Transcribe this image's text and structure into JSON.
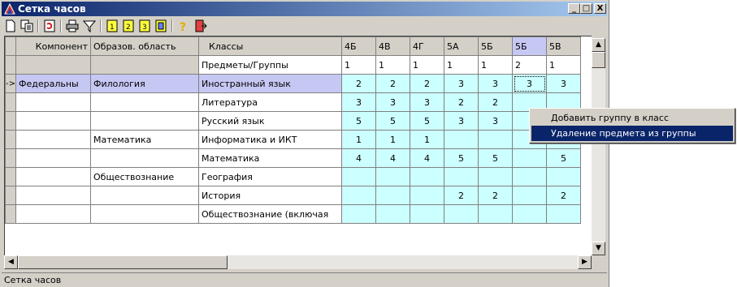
{
  "window": {
    "title": "Сетка часов"
  },
  "titlebar_buttons": {
    "minimize": "_",
    "maximize": "□",
    "close": "X"
  },
  "toolbar": {
    "items": [
      "new-icon",
      "copy-icon",
      "refresh-icon",
      "print-icon",
      "filter-icon",
      "doc1-icon",
      "doc2-icon",
      "doc3-icon",
      "report-icon",
      "help-icon",
      "exit-icon"
    ]
  },
  "grid": {
    "columns": [
      "Компонент",
      "Образов. область",
      "Классы",
      "4Б",
      "4В",
      "4Г",
      "5А",
      "5Б",
      "5Б",
      "5В"
    ],
    "subheader": {
      "label": "Предметы/Группы",
      "values": [
        "1",
        "1",
        "1",
        "1",
        "1",
        "2",
        "1"
      ]
    },
    "rows": [
      {
        "indicator": "->",
        "component": "Федеральны",
        "area": "Филология",
        "subject": "Иностранный язык",
        "values": [
          "2",
          "2",
          "2",
          "3",
          "3",
          "3",
          "3"
        ]
      },
      {
        "indicator": "",
        "component": "",
        "area": "",
        "subject": "Литература",
        "values": [
          "3",
          "3",
          "3",
          "2",
          "2",
          "",
          ""
        ]
      },
      {
        "indicator": "",
        "component": "",
        "area": "",
        "subject": "Русский язык",
        "values": [
          "5",
          "5",
          "5",
          "3",
          "3",
          "",
          ""
        ]
      },
      {
        "indicator": "",
        "component": "",
        "area": "Математика",
        "subject": "Информатика и ИКТ",
        "values": [
          "1",
          "1",
          "1",
          "",
          "",
          "",
          ""
        ]
      },
      {
        "indicator": "",
        "component": "",
        "area": "",
        "subject": "Математика",
        "values": [
          "4",
          "4",
          "4",
          "5",
          "5",
          "",
          "5"
        ]
      },
      {
        "indicator": "",
        "component": "",
        "area": "Обществознание",
        "subject": "География",
        "values": [
          "",
          "",
          "",
          "",
          "",
          "",
          ""
        ]
      },
      {
        "indicator": "",
        "component": "",
        "area": "",
        "subject": "История",
        "values": [
          "",
          "",
          "",
          "2",
          "2",
          "",
          "2"
        ]
      },
      {
        "indicator": "",
        "component": "",
        "area": "",
        "subject": "Обществознание (включая",
        "values": [
          "",
          "",
          "",
          "",
          "",
          "",
          ""
        ]
      }
    ]
  },
  "context_menu": {
    "items": [
      "Добавить группу в класс",
      "Удаление предмета из группы"
    ]
  },
  "statusbar": {
    "text": "Сетка часов"
  }
}
